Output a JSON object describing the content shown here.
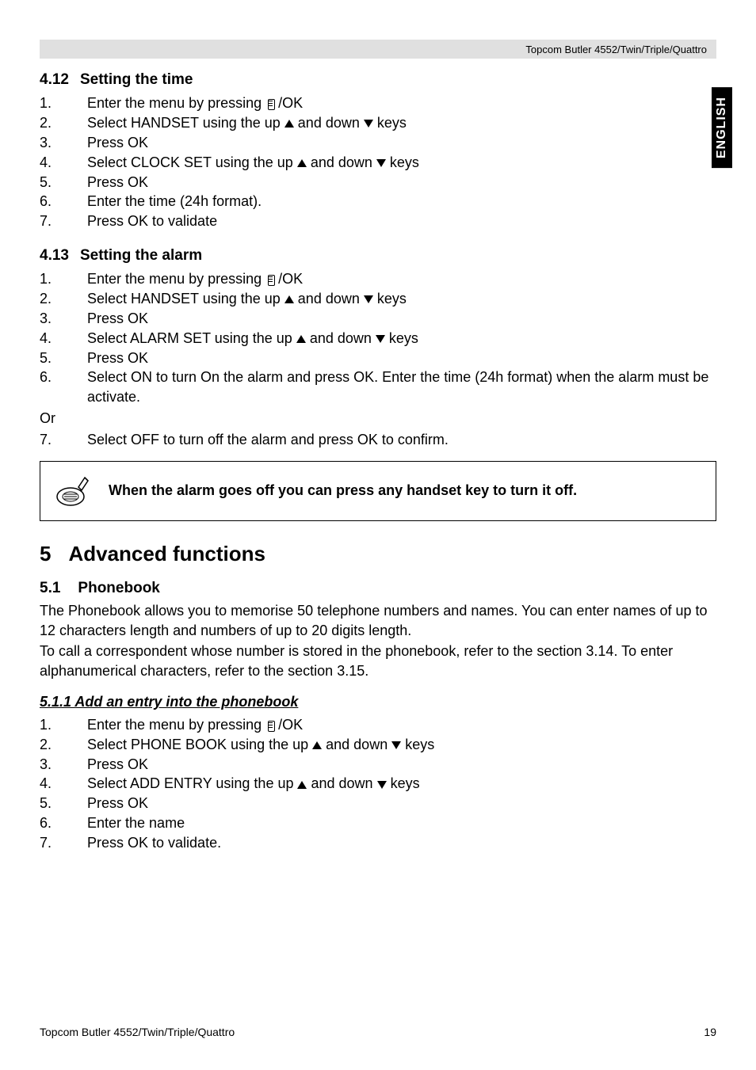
{
  "header": {
    "product": "Topcom Butler 4552/Twin/Triple/Quattro"
  },
  "langTab": "ENGLISH",
  "section412": {
    "num": "4.12",
    "title": "Setting the time",
    "items": [
      {
        "n": "1.",
        "pre": "Enter the menu by pressing ",
        "post": "/OK",
        "icon": "menu"
      },
      {
        "n": "2.",
        "pre": "Select HANDSET using the up ",
        "mid": " and down ",
        "post": " keys",
        "icons": "updown"
      },
      {
        "n": "3.",
        "text": "Press OK"
      },
      {
        "n": "4.",
        "pre": "Select CLOCK SET using the up ",
        "mid": " and down ",
        "post": " keys",
        "icons": "updown"
      },
      {
        "n": "5.",
        "text": "Press OK"
      },
      {
        "n": "6.",
        "text": "Enter the time (24h format)."
      },
      {
        "n": "7.",
        "text": "Press OK to validate"
      }
    ]
  },
  "section413": {
    "num": "4.13",
    "title": "Setting the alarm",
    "items": [
      {
        "n": "1.",
        "pre": "Enter the menu by pressing ",
        "post": "/OK",
        "icon": "menu"
      },
      {
        "n": "2.",
        "pre": "Select HANDSET using the up ",
        "mid": " and down ",
        "post": " keys",
        "icons": "updown"
      },
      {
        "n": "3.",
        "text": "Press OK"
      },
      {
        "n": "4.",
        "pre": "Select ALARM SET using the up ",
        "mid": " and down ",
        "post": " keys",
        "icons": "updown"
      },
      {
        "n": "5.",
        "text": "Press OK"
      },
      {
        "n": "6.",
        "text": "Select ON to turn On the alarm and press OK.  Enter the time (24h format) when the alarm must be activate."
      }
    ],
    "or": "Or",
    "item7": {
      "n": "7.",
      "text": "Select OFF to turn off the alarm and press OK to confirm."
    }
  },
  "noteBox": {
    "text": "When the alarm goes off you can press any handset key to turn it off."
  },
  "section5": {
    "num": "5",
    "title": "Advanced functions"
  },
  "section51": {
    "num": "5.1",
    "title": "Phonebook",
    "para1": "The Phonebook allows you to memorise 50 telephone numbers and names. You can enter names of up to 12 characters length and numbers of up to 20 digits length.",
    "para2": "To call a correspondent whose number is stored in the phonebook, refer to the section 3.14. To enter alphanumerical characters, refer to the section 3.15."
  },
  "section511": {
    "titleFull": "5.1.1 Add an entry into the phonebook",
    "items": [
      {
        "n": "1.",
        "pre": "Enter the menu by pressing ",
        "post": "/OK",
        "icon": "menu"
      },
      {
        "n": "2.",
        "pre": "Select PHONE BOOK using the up ",
        "mid": " and down ",
        "post": "  keys",
        "icons": "updown"
      },
      {
        "n": "3.",
        "text": "Press OK"
      },
      {
        "n": "4.",
        "pre": "Select ADD ENTRY using the up ",
        "mid": " and down ",
        "post": " keys",
        "icons": "updown"
      },
      {
        "n": "5.",
        "text": "Press OK"
      },
      {
        "n": "6.",
        "text": "Enter the name"
      },
      {
        "n": "7.",
        "text": "Press OK to validate."
      }
    ]
  },
  "footer": {
    "left": "Topcom Butler 4552/Twin/Triple/Quattro",
    "right": "19"
  }
}
